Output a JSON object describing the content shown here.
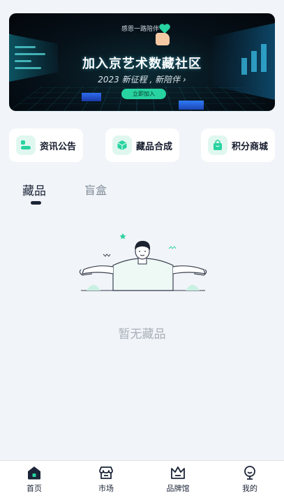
{
  "banner": {
    "small_text": "感恩一路陪伴",
    "headline": "加入京艺术数藏社区",
    "subline": "2023 新征程 , 新陪伴 ›",
    "button_label": "立即加入"
  },
  "shortcuts": [
    {
      "label": "资讯公告",
      "icon": "news-icon"
    },
    {
      "label": "藏品合成",
      "icon": "cube-icon"
    },
    {
      "label": "积分商城",
      "icon": "shopping-bag-icon"
    }
  ],
  "tabs": [
    {
      "label": "藏品",
      "active": true
    },
    {
      "label": "盲盒",
      "active": false
    }
  ],
  "empty_state": {
    "text": "暂无藏品"
  },
  "bottom_nav": [
    {
      "label": "首页",
      "icon": "home-icon",
      "active": true
    },
    {
      "label": "市场",
      "icon": "market-icon",
      "active": false
    },
    {
      "label": "品牌馆",
      "icon": "crown-icon",
      "active": false
    },
    {
      "label": "我的",
      "icon": "profile-icon",
      "active": false
    }
  ],
  "colors": {
    "accent": "#27d3a0",
    "background": "#f1f4f8",
    "text_primary": "#1b2438",
    "text_muted": "#a9b0b9"
  }
}
